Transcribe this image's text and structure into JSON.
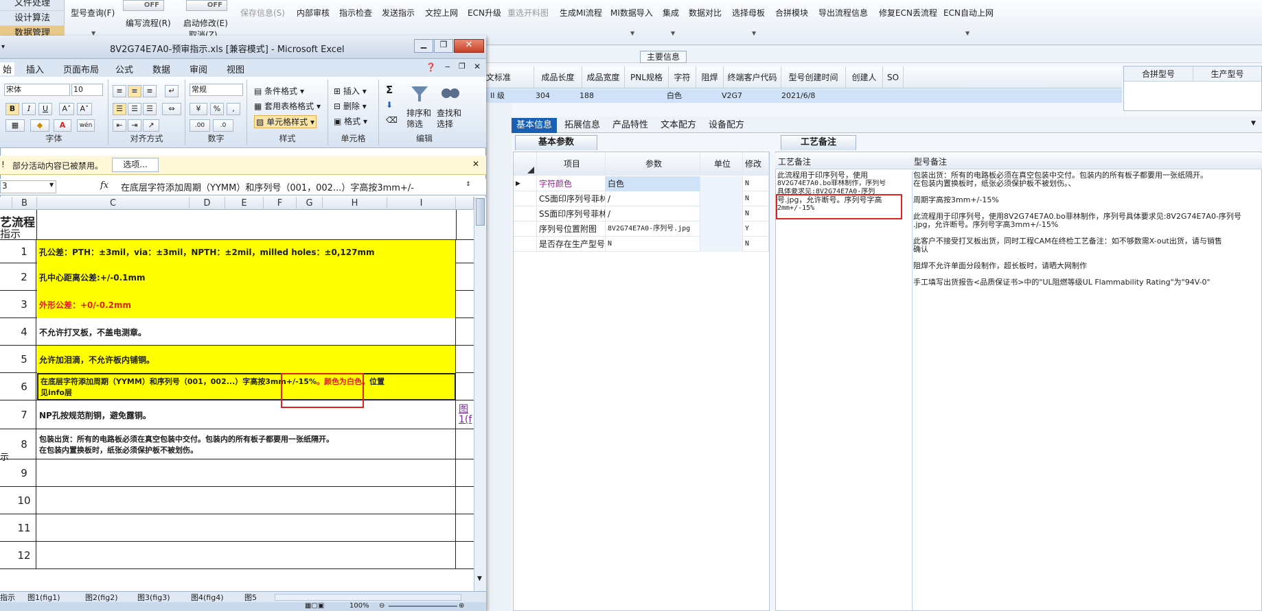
{
  "left_nav": {
    "items": [
      "文件处理",
      "设计算法",
      "数据管理"
    ]
  },
  "toolbar": {
    "items": [
      "型号查询(F)",
      "编写流程(R)",
      "启动修改(E)",
      "保存信息(S)",
      "内部审核",
      "指示检查",
      "发送指示",
      "文控上网",
      "ECN升级",
      "重选开料图",
      "生成MI流程",
      "MI数据导入",
      "集成",
      "数据对比",
      "选择母板",
      "合拼模块",
      "导出流程信息",
      "修复ECN丢流程",
      "ECN自动上网"
    ],
    "cancel": "取消(Z)",
    "off": "OFF"
  },
  "main_info": {
    "label": "主要信息",
    "columns": [
      "文标准",
      "成品长度",
      "成品宽度",
      "PNL规格",
      "字符",
      "阻焊",
      "终端客户代码",
      "型号创建时间",
      "创建人",
      "SO"
    ],
    "row": [
      "II 级",
      "304",
      "188",
      "",
      "白色",
      "",
      "V2G7",
      "2021/6/8",
      "",
      ""
    ],
    "side_columns": [
      "合拼型号",
      "生产型号"
    ]
  },
  "detail_tabs": [
    "基本信息",
    "拓展信息",
    "产品特性",
    "文本配方",
    "设备配方"
  ],
  "basic_params": {
    "tab": "基本参数",
    "columns": [
      "项目",
      "参数",
      "单位",
      "修改"
    ],
    "rows": [
      [
        "字符颜色",
        "白色",
        "",
        "N"
      ],
      [
        "CS面印序列号菲林",
        "/",
        "",
        "N"
      ],
      [
        "SS面印序列号菲林",
        "/",
        "",
        "N"
      ],
      [
        "序列号位置附图",
        "8V2G74E7A0-序列号.jpg",
        "",
        "Y"
      ],
      [
        "是否存在生产型号",
        "N",
        "",
        "N"
      ]
    ]
  },
  "process_notes": {
    "tab": "工艺备注",
    "col1_header": "工艺备注",
    "col2_header": "型号备注",
    "col1_text": [
      "此流程用于印序列号，使用",
      "8V2G74E7A0.bo菲林制作，序列号",
      "具体要求见:8V2G74E7A0-序列",
      "号.jpg，允许断号。序列号字高",
      "2mm+/-15%"
    ],
    "col2_text": [
      "包装出货：所有的电路板必须在真空包装中交付。包装内的所有板子都要用一张纸隔开。",
      "在包装内置换板时，纸张必须保护板不被划伤。、",
      "",
      "周期字高按3mm+/-15%",
      "",
      "此流程用于印序列号，使用8V2G74E7A0.bo菲林制作，序列号具体要求见:8V2G74E7A0-序列号",
      "  .jpg，允许断号。序列号字高3mm+/-15%",
      "",
      "此客户不接受打叉板出货，同时工程CAM在终检工艺备注：如不够数需X-out出货，请与销售",
      "确认",
      "",
      "阻焊不允许单面分段制作，超长板时，请晒大网制作",
      "",
      "手工填写出货报告<品质保证书>中的\"UL阻燃等级UL Flammability Rating\"为\"94V-0\""
    ]
  },
  "excel": {
    "title": "8V2G74E7A0-预审指示.xls  [兼容模式] - Microsoft Excel",
    "tabs": [
      "始",
      "插入",
      "页面布局",
      "公式",
      "数据",
      "审阅",
      "视图"
    ],
    "font_name": "宋体",
    "font_size": "10",
    "number_format": "常规",
    "groups": [
      "字体",
      "对齐方式",
      "数字",
      "样式",
      "单元格",
      "编辑"
    ],
    "styles_buttons": [
      "条件格式",
      "套用表格格式",
      "单元格样式"
    ],
    "cell_buttons": [
      "插入",
      "删除",
      "格式"
    ],
    "edit_buttons": [
      "排序和",
      "筛选",
      "查找和",
      "选择"
    ],
    "security_text": "部分活动内容已被禁用。",
    "security_button": "选项...",
    "name_box": "3",
    "formula": "在底层字符添加周期（YYMM）和序列号（001，002...）字高按3mm+/-",
    "columns": [
      "B",
      "C",
      "D",
      "E",
      "F",
      "G",
      "H",
      "I"
    ],
    "header_cell": [
      "艺流程",
      "指示"
    ],
    "rows": [
      {
        "n": "1",
        "text": "孔公差：PTH：±3mil，via：±3mil，NPTH：±2mil，milled holes：±0,127mm"
      },
      {
        "n": "2",
        "text": "孔中心距离公差:+/-0.1mm"
      },
      {
        "n": "3",
        "text": "外形公差：+0/-0.2mm"
      },
      {
        "n": "4",
        "text": "不允许打叉板，不盖电测章。"
      },
      {
        "n": "5",
        "text": "允许加泪滴，不允许板内铺铜。"
      },
      {
        "n": "6",
        "text": "在底层字符添加周期（YYMM）和序列号（001，002...）字高按3mm+/-15%",
        "red": "。颜色为白色。",
        "rest": "位置",
        "line2": "见info层"
      },
      {
        "n": "7",
        "text": "NP孔按规范削铜，避免露铜。",
        "link": "图",
        "link2": "1(f"
      },
      {
        "n": "8",
        "text": "包装出货：所有的电路板必须在真空包装中交付。包装内的所有板子都要用一张纸隔开。",
        "line2": "在包装内置换板时，纸张必须保护板不被划伤。"
      },
      {
        "n": "9",
        "text": ""
      },
      {
        "n": "10",
        "text": ""
      },
      {
        "n": "11",
        "text": ""
      },
      {
        "n": "12",
        "text": ""
      }
    ],
    "sheet_tabs": [
      "指示",
      "图1(fig1)",
      "图2(fig2)",
      "图3(fig3)",
      "图4(fig4)",
      "图5"
    ],
    "zoom": "100%",
    "side_label": "示"
  },
  "colors": {
    "yellow": "#ffff00",
    "red": "#e02020",
    "accent": "#1a5fb4"
  }
}
